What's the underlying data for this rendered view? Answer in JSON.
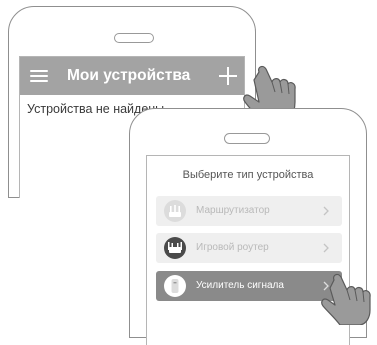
{
  "screen_devices": {
    "title": "Мои устройства",
    "empty_message": "Устройства не найдены.",
    "menu_icon": "hamburger-menu-icon",
    "add_icon": "plus-icon"
  },
  "screen_select": {
    "title": "Выберите тип устройства",
    "options": [
      {
        "label": "Маршрутизатор",
        "icon": "router-icon",
        "state": "disabled"
      },
      {
        "label": "Игровой роутер",
        "icon": "gaming-router-icon",
        "state": "disabled"
      },
      {
        "label": "Усилитель сигнала",
        "icon": "range-extender-icon",
        "state": "selected"
      }
    ],
    "chevron_icon": "chevron-right-icon"
  },
  "colors": {
    "appbar": "#a3a3a3",
    "selected_option": "#8a8a8a",
    "disabled_option": "#efefef",
    "phone_outline": "#8f8f8f"
  }
}
